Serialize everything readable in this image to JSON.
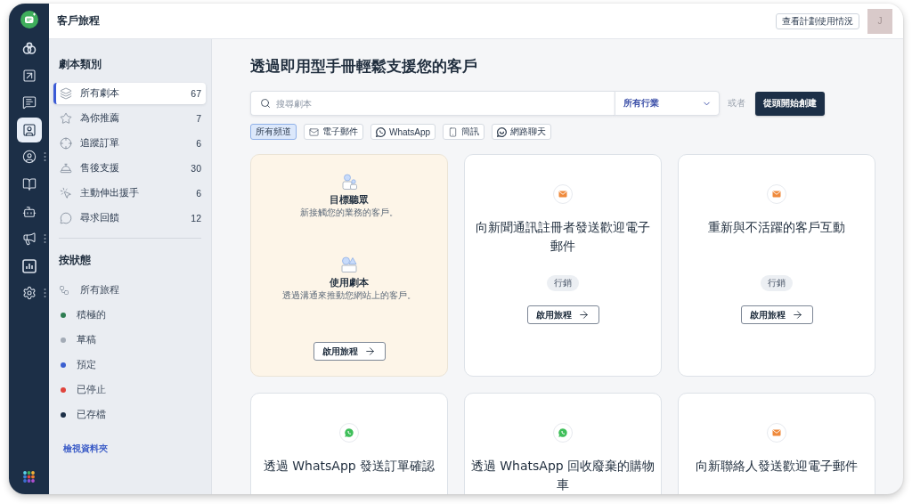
{
  "rail": {
    "items": [
      {
        "kind": "circles",
        "selected": false,
        "submenu": false
      },
      {
        "kind": "board",
        "selected": false,
        "submenu": false
      },
      {
        "kind": "chat",
        "selected": false,
        "submenu": false
      },
      {
        "kind": "journey",
        "selected": true,
        "submenu": false
      },
      {
        "kind": "contacts",
        "selected": false,
        "submenu": true
      },
      {
        "kind": "book",
        "selected": false,
        "submenu": false
      },
      {
        "kind": "robot",
        "selected": false,
        "submenu": false
      },
      {
        "kind": "campaign",
        "selected": false,
        "submenu": true
      },
      {
        "kind": "analytics",
        "selected": false,
        "submenu": false
      },
      {
        "kind": "settings",
        "selected": false,
        "submenu": true
      }
    ]
  },
  "header": {
    "title": "客戶旅程",
    "plan_button": "查看計劃使用情況",
    "avatar": "J"
  },
  "sidebar": {
    "categories": {
      "heading": "劇本類別",
      "items": [
        {
          "kind": "layers",
          "label": "所有劇本",
          "count": "67",
          "selected": true
        },
        {
          "kind": "star",
          "label": "為你推薦",
          "count": "7",
          "selected": false
        },
        {
          "kind": "target",
          "label": "追蹤訂單",
          "count": "6",
          "selected": false
        },
        {
          "kind": "bell",
          "label": "售後支援",
          "count": "30",
          "selected": false
        },
        {
          "kind": "pointer",
          "label": "主動伸出援手",
          "count": "6",
          "selected": false
        },
        {
          "kind": "bubble",
          "label": "尋求回饋",
          "count": "12",
          "selected": false
        }
      ]
    },
    "statuses": {
      "heading": "按狀態",
      "items": [
        {
          "kind": "all",
          "label": "所有旅程",
          "selected": false
        },
        {
          "kind": "dot",
          "label": "積極的",
          "color": "#2e7d52",
          "selected": false
        },
        {
          "kind": "dot",
          "label": "草稿",
          "color": "#a3abb6",
          "selected": false
        },
        {
          "kind": "dot",
          "label": "預定",
          "color": "#3b5fd0",
          "selected": false
        },
        {
          "kind": "dot",
          "label": "已停止",
          "color": "#e0443c",
          "selected": false
        },
        {
          "kind": "dot",
          "label": "已存檔",
          "color": "#1c2f47",
          "selected": false
        }
      ]
    },
    "folders_link": "檢視資料夾"
  },
  "main": {
    "title": "透過即用型手冊輕鬆支援您的客戶",
    "search": {
      "placeholder": "搜尋劇本"
    },
    "industry_select": {
      "value": "所有行業"
    },
    "or_text": "或者",
    "create_button": "從頭開始創建",
    "channels": [
      {
        "kind": "all",
        "label": "所有頻道",
        "selected": true
      },
      {
        "kind": "email",
        "label": "電子郵件",
        "selected": false
      },
      {
        "kind": "whatsapp",
        "label": "WhatsApp",
        "selected": false
      },
      {
        "kind": "sms",
        "label": "簡訊",
        "selected": false
      },
      {
        "kind": "webchat",
        "label": "網路聊天",
        "selected": false
      }
    ],
    "cards": [
      {
        "kind": "info",
        "sections": [
          {
            "kind": "audience",
            "title": "目標聽眾",
            "description": "新接觸您的業務的客戶。"
          },
          {
            "kind": "playbook",
            "title": "使用劇本",
            "description": "透過溝通來推動您網站上的客戶。"
          }
        ],
        "button": "啟用旅程"
      },
      {
        "kind": "email",
        "title": "向新聞通訊註冊者發送歡迎電子郵件",
        "tag": "行銷",
        "button": "啟用旅程"
      },
      {
        "kind": "email",
        "title": "重新與不活躍的客戶互動",
        "tag": "行銷",
        "button": "啟用旅程"
      },
      {
        "kind": "whatsapp",
        "title": "透過 WhatsApp 發送訂單確認"
      },
      {
        "kind": "whatsapp",
        "title": "透過 WhatsApp 回收廢棄的購物車"
      },
      {
        "kind": "email",
        "title": "向新聯絡人發送歡迎電子郵件"
      }
    ]
  }
}
